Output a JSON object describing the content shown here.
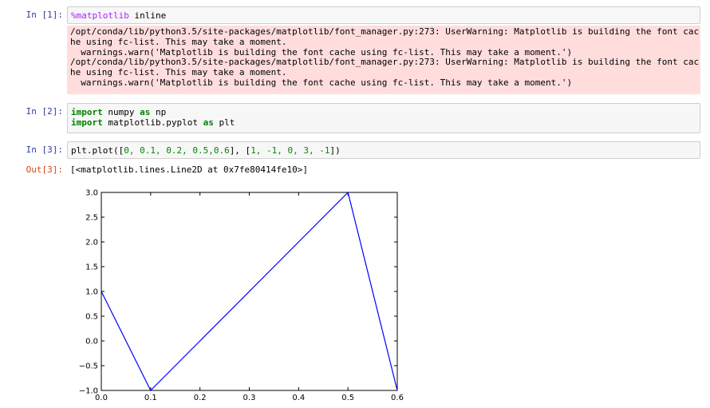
{
  "cells": [
    {
      "prompt": "In [1]:",
      "magic": "%matplotlib",
      "code_rest": " inline",
      "stderr": [
        "/opt/conda/lib/python3.5/site-packages/matplotlib/font_manager.py:273: UserWarning: Matplotlib is building the font cac",
        "he using fc-list. This may take a moment.",
        "  warnings.warn('Matplotlib is building the font cache using fc-list. This may take a moment.')",
        "/opt/conda/lib/python3.5/site-packages/matplotlib/font_manager.py:273: UserWarning: Matplotlib is building the font cac",
        "he using fc-list. This may take a moment.",
        "  warnings.warn('Matplotlib is building the font cache using fc-list. This may take a moment.')"
      ]
    },
    {
      "prompt": "In [2]:",
      "line1": {
        "kw1": "import",
        "mid": " numpy ",
        "kw2": "as",
        "rest": " np"
      },
      "line2": {
        "kw1": "import",
        "mid": " matplotlib.pyplot ",
        "kw2": "as",
        "rest": " plt"
      }
    },
    {
      "prompt": "In [3]:",
      "code_prefix": "plt.plot([",
      "list1": "0, 0.1, 0.2, 0.5,0.6",
      "code_mid": "], [",
      "list2": "1, -1, 0, 3, -1",
      "code_suffix": "])",
      "out_prompt": "Out[3]:",
      "output": "[<matplotlib.lines.Line2D at 0x7fe80414fe10>]"
    }
  ],
  "chart_data": {
    "type": "line",
    "x": [
      0,
      0.1,
      0.2,
      0.5,
      0.6
    ],
    "series": [
      {
        "values": [
          1,
          -1,
          0,
          3,
          -1
        ],
        "color": "#0000ff"
      }
    ],
    "xlim": [
      0.0,
      0.6
    ],
    "ylim": [
      -1.0,
      3.0
    ],
    "xticks": [
      "0.0",
      "0.1",
      "0.2",
      "0.3",
      "0.4",
      "0.5",
      "0.6"
    ],
    "yticks": [
      "3.0",
      "2.5",
      "2.0",
      "1.5",
      "1.0",
      "0.5",
      "0.0",
      "−0.5",
      "−1.0"
    ],
    "xtick_values": [
      0.0,
      0.1,
      0.2,
      0.3,
      0.4,
      0.5,
      0.6
    ],
    "ytick_values": [
      3.0,
      2.5,
      2.0,
      1.5,
      1.0,
      0.5,
      0.0,
      -0.5,
      -1.0
    ],
    "grid": false
  }
}
